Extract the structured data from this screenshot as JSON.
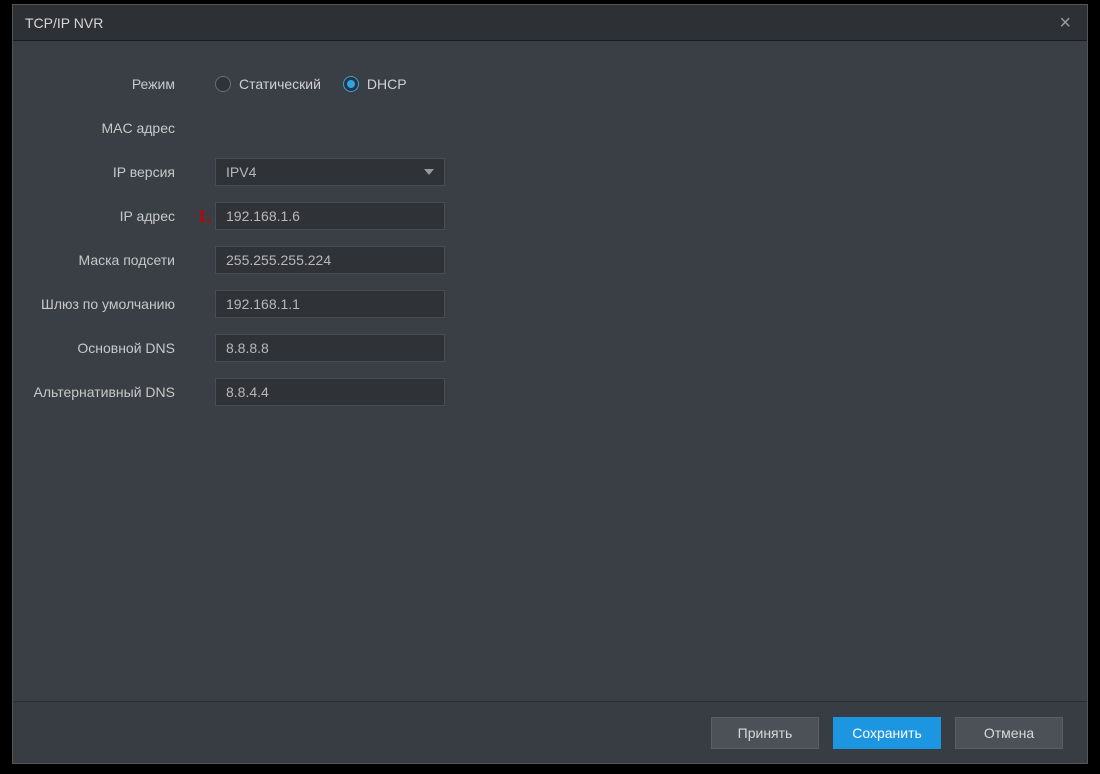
{
  "dialog": {
    "title": "TCP/IP NVR",
    "close_tooltip": "Close"
  },
  "form": {
    "mode": {
      "label": "Режим",
      "options": {
        "static": "Статический",
        "dhcp": "DHCP"
      },
      "selected": "dhcp"
    },
    "mac": {
      "label": "MAC адрес"
    },
    "ip_version": {
      "label": "IP версия",
      "value": "IPV4"
    },
    "ip_address": {
      "label": "IP адрес",
      "value": "192.168.1.6",
      "annotation": "1."
    },
    "subnet_mask": {
      "label": "Маска подсети",
      "value": "255.255.255.224"
    },
    "gateway": {
      "label": "Шлюз по умолчанию",
      "value": "192.168.1.1"
    },
    "dns_primary": {
      "label": "Основной DNS",
      "value": "8.8.8.8"
    },
    "dns_alt": {
      "label": "Альтернативный DNS",
      "value": "8.8.4.4"
    }
  },
  "footer": {
    "apply": "Принять",
    "save": "Сохранить",
    "cancel": "Отмена"
  }
}
